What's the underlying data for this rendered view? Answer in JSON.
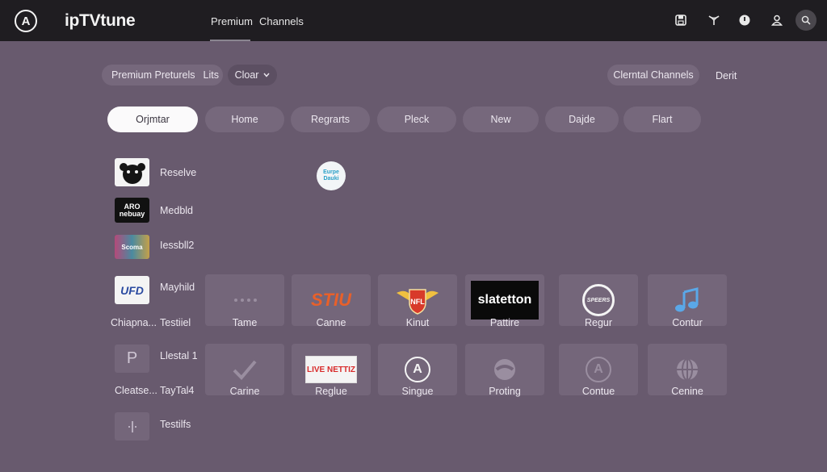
{
  "header": {
    "brand": "ipTVtune",
    "nav": [
      "Premium",
      "Channels"
    ],
    "icons": [
      "save-icon",
      "antenna-icon",
      "power-icon",
      "user-icon",
      "search-icon"
    ]
  },
  "filters": {
    "left_pill": "Premium Preturels",
    "left_pill_suffix": "Lits",
    "dropdown_label": "Cloar",
    "right_pill": "Clerntal Channels",
    "right_text": "Derit"
  },
  "tabs": [
    "Orjmtar",
    "Home",
    "Regrarts",
    "Pleck",
    "New",
    "Dajde",
    "Flart"
  ],
  "floating_logo_text": "Eurpe Dauki",
  "list": [
    {
      "label": "Reselve",
      "thumb_text": "",
      "icon": "gamepad-icon"
    },
    {
      "label": "Medbld",
      "thumb_text": "ARO nebuay",
      "icon": ""
    },
    {
      "label": "Iessbll2",
      "thumb_text": "Scoma",
      "icon": ""
    },
    {
      "label": "Mayhild",
      "thumb_text": "UFD",
      "icon": "",
      "sub": "Chiapna..."
    },
    {
      "label": "Llestal 1",
      "thumb_text": "P",
      "icon": "",
      "sub": "Cleatse..."
    },
    {
      "label": "Testilfs",
      "thumb_text": "",
      "icon": "move-icon"
    }
  ],
  "row_labels": [
    "Testiiel",
    "TayTal4"
  ],
  "grid": [
    [
      {
        "label": "Tame",
        "icon": "ellipsis-icon",
        "logo_text": ""
      },
      {
        "label": "Canne",
        "icon": "",
        "logo_text": "STIU"
      },
      {
        "label": "Kinut",
        "icon": "shield-badge-icon",
        "logo_text": "NFL"
      },
      {
        "label": "Pattire",
        "icon": "",
        "logo_text": "slatetton"
      },
      {
        "label": "Regur",
        "icon": "",
        "logo_text": "SPEERS"
      },
      {
        "label": "Contur",
        "icon": "music-note-icon",
        "logo_text": ""
      }
    ],
    [
      {
        "label": "Carine",
        "icon": "checkmark-icon",
        "logo_text": ""
      },
      {
        "label": "Reglue",
        "icon": "",
        "logo_text": "LIVE NETTIZ"
      },
      {
        "label": "Singue",
        "icon": "a-badge-icon",
        "logo_text": ""
      },
      {
        "label": "Proting",
        "icon": "swirl-icon",
        "logo_text": ""
      },
      {
        "label": "Contue",
        "icon": "a-badge-icon",
        "logo_text": ""
      },
      {
        "label": "Cenine",
        "icon": "globe-icon",
        "logo_text": ""
      }
    ]
  ]
}
